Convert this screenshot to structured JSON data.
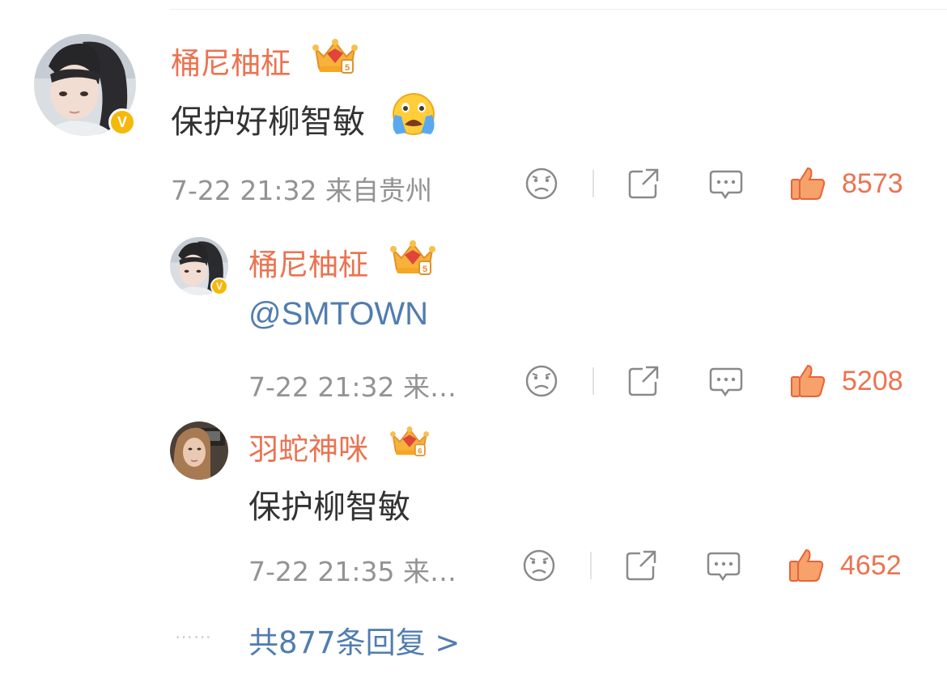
{
  "comment": {
    "username": "桶尼柚柾",
    "crown_level": "5",
    "text": "保护好柳智敏",
    "emoji": "crying-face",
    "meta": "7-22 21:32 来自贵州",
    "likes": "8573"
  },
  "replies": [
    {
      "username": "桶尼柚柾",
      "crown_level": "5",
      "text": "@SMTOWN",
      "meta": "7-22 21:32 来…",
      "likes": "5208"
    },
    {
      "username": "羽蛇神咪",
      "crown_level": "6",
      "text": "保护柳智敏",
      "meta": "7-22 21:35 来…",
      "likes": "4652"
    }
  ],
  "more_replies": {
    "dots": "……",
    "label": "共877条回复 >"
  },
  "colors": {
    "username": "#eb7350",
    "like": "#eb7350",
    "link": "#507daf",
    "meta": "#939393",
    "text": "#333333",
    "badge": "#f5b90b"
  }
}
